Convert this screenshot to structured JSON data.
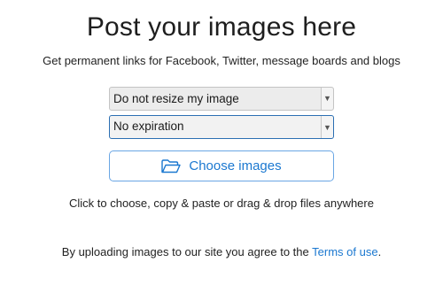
{
  "page": {
    "title": "Post your images here",
    "subtitle": "Get permanent links for Facebook, Twitter, message boards and blogs"
  },
  "resize_select": {
    "selected": "Do not resize my image"
  },
  "expiration_select": {
    "selected": "No expiration"
  },
  "upload": {
    "button_label": "Choose images",
    "hint": "Click to choose, copy & paste or drag & drop files anywhere"
  },
  "footer": {
    "text_before": "By uploading images to our site you agree to the ",
    "link_label": "Terms of use",
    "text_after": "."
  },
  "colors": {
    "accent": "#1b78d0",
    "button_border": "#6aa6e4",
    "select_focus": "#2b6fb3"
  },
  "icons": {
    "upload_button": "folder-open-icon",
    "select_arrow": "chevron-down-icon"
  }
}
